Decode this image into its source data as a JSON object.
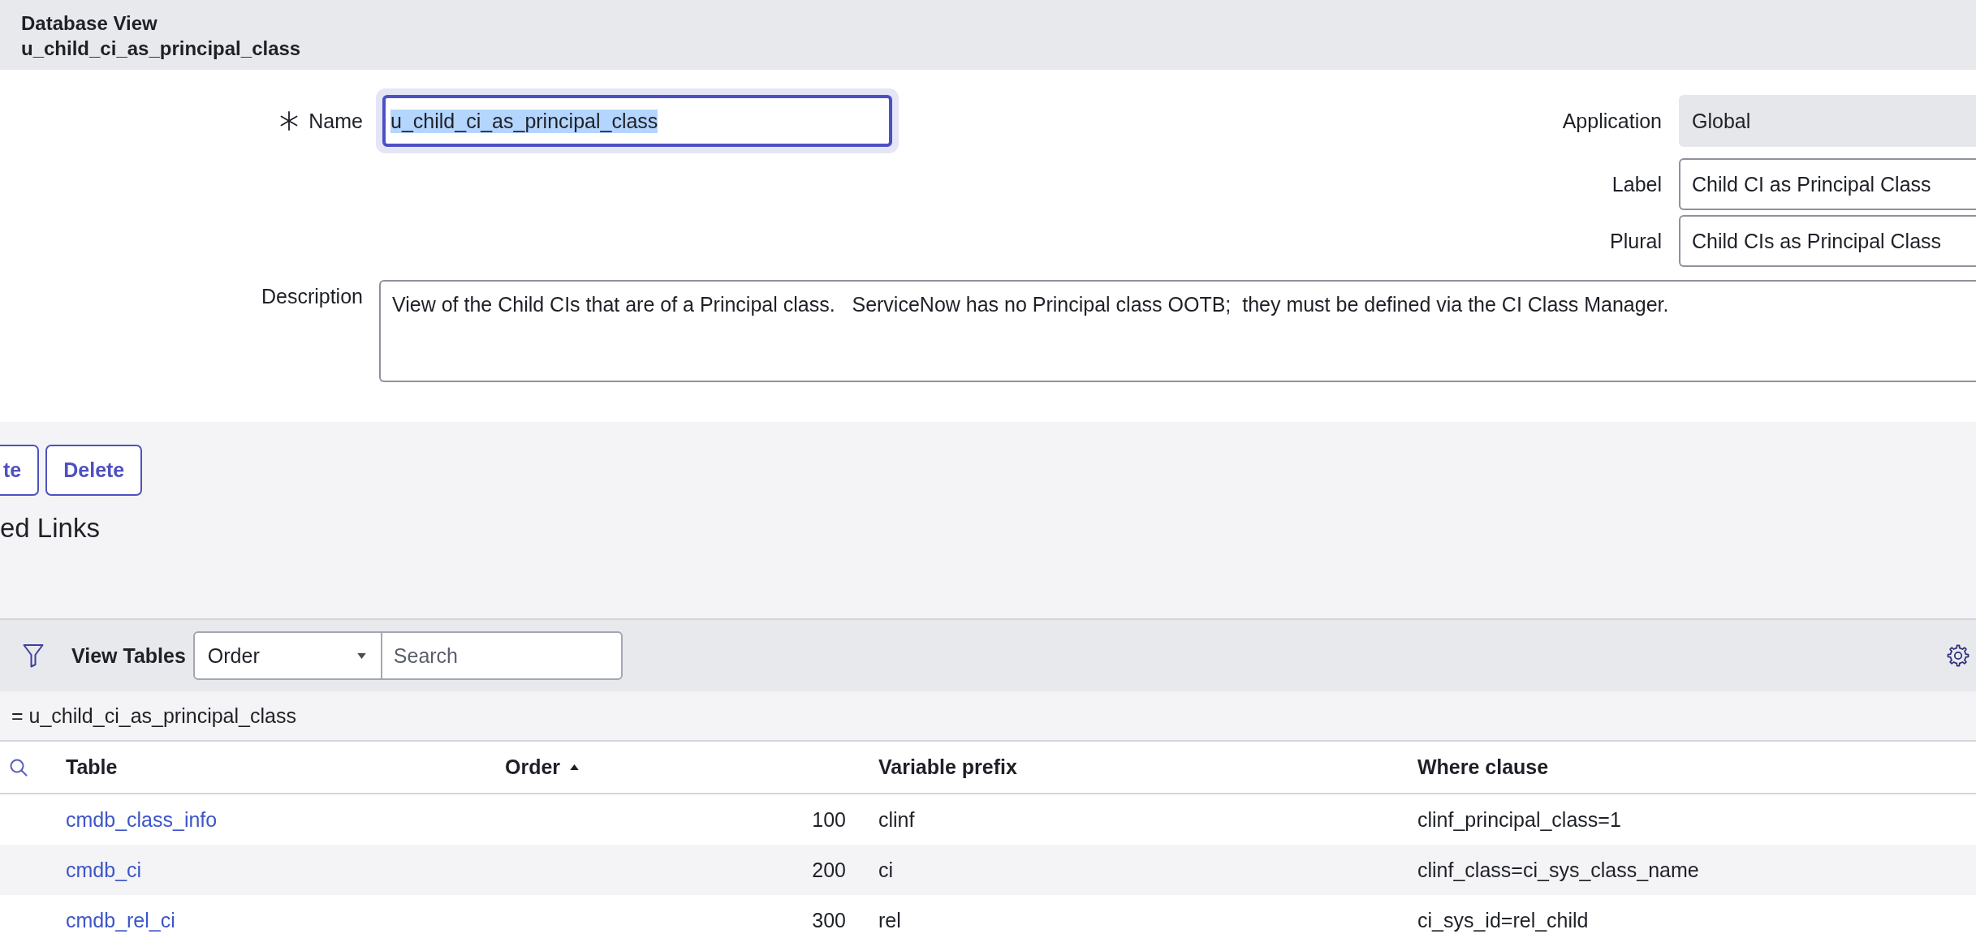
{
  "header": {
    "title": "Database View",
    "record": "u_child_ci_as_principal_class"
  },
  "form": {
    "name": {
      "label": "Name",
      "value": "u_child_ci_as_principal_class",
      "required": true,
      "focused": true,
      "value_selected": true
    },
    "application": {
      "label": "Application",
      "value": "Global",
      "read_only": true
    },
    "label": {
      "label": "Label",
      "value": "Child CI as Principal Class"
    },
    "plural": {
      "label": "Plural",
      "value": "Child CIs as Principal Class"
    },
    "description": {
      "label": "Description",
      "value": "View of the Child CIs that are of a Principal class.   ServiceNow has no Principal class OOTB;  they must be defined via the CI Class Manager."
    }
  },
  "buttons": [
    {
      "label": "te"
    },
    {
      "label": "Delete"
    }
  ],
  "related_links": {
    "title": "ed Links"
  },
  "related_list": {
    "toolbar": {
      "title": "View Tables",
      "sort_field": {
        "value": "Order"
      },
      "search": {
        "placeholder": "Search"
      }
    },
    "breadcrumb": "= u_child_ci_as_principal_class",
    "columns": [
      {
        "label": "Table",
        "sorted_ascending": false
      },
      {
        "label": "Order",
        "sorted_ascending": true
      },
      {
        "label": "Variable prefix",
        "sorted_ascending": false
      },
      {
        "label": "Where clause",
        "sorted_ascending": false
      }
    ],
    "rows": [
      {
        "table": "cmdb_class_info",
        "order": "100",
        "variable_prefix": "clinf",
        "where_clause": "clinf_principal_class=1"
      },
      {
        "table": "cmdb_ci",
        "order": "200",
        "variable_prefix": "ci",
        "where_clause": "clinf_class=ci_sys_class_name"
      },
      {
        "table": "cmdb_rel_ci",
        "order": "300",
        "variable_prefix": "rel",
        "where_clause": "ci_sys_id=rel_child"
      }
    ]
  }
}
